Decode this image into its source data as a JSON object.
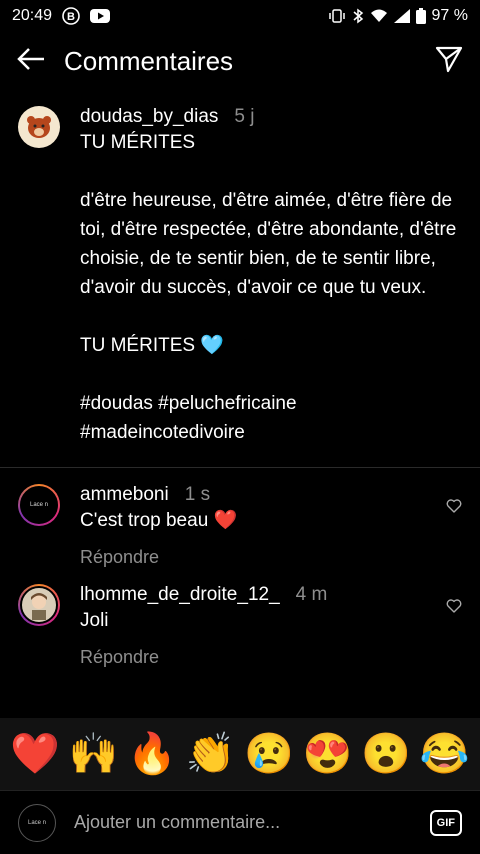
{
  "status_bar": {
    "time": "20:49",
    "battery": "97 %"
  },
  "header": {
    "title": "Commentaires"
  },
  "post": {
    "username": "doudas_by_dias",
    "time": "5 j",
    "text": "TU MÉRITES\n\nd'être heureuse, d'être aimée, d'être fière de toi, d'être respectée, d'être abondante, d'être choisie, de te sentir bien, de te sentir libre, d'avoir du succès, d'avoir ce que tu veux.\n\nTU MÉRITES 🩵\n\n#doudas #peluchefricaine\n#madeincotedivoire"
  },
  "comments": [
    {
      "username": "ammeboni",
      "time": "1 s",
      "text": "C'est trop beau ❤️",
      "reply": "Répondre",
      "avatar_text": "Lace n"
    },
    {
      "username": "lhomme_de_droite_12_",
      "time": "4 m",
      "text": "Joli",
      "reply": "Répondre"
    }
  ],
  "emojis": [
    "❤️",
    "🙌",
    "🔥",
    "👏",
    "😢",
    "😍",
    "😮",
    "😂"
  ],
  "input": {
    "placeholder": "Ajouter un commentaire...",
    "gif_label": "GIF",
    "avatar_text": "Lace n"
  }
}
